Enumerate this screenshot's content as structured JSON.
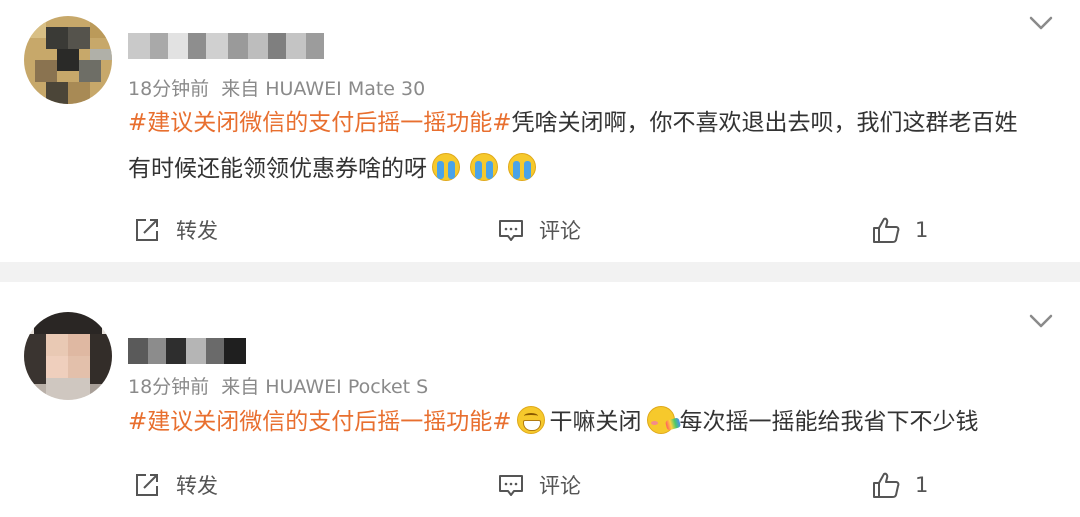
{
  "posts": [
    {
      "time": "18分钟前",
      "source": "来自 HUAWEI Mate 30",
      "topic": "#建议关闭微信的支付后摇一摇功能#",
      "text_line1": "凭啥关闭啊，你不喜欢退出去呗，我们这群老百姓",
      "text_line2": "有时候还能领领优惠券啥的呀",
      "emojis": [
        "crying-face",
        "crying-face",
        "crying-face"
      ],
      "actions": {
        "repost_label": "转发",
        "comment_label": "评论",
        "like_count": "1"
      }
    },
    {
      "time": "18分钟前",
      "source": "来自 HUAWEI Pocket S",
      "topic": "#建议关闭微信的支付后摇一摇功能#",
      "text_part1": "干嘛关闭",
      "text_part2": "每次摇一摇能给我省下不少钱",
      "emojis": [
        "grinning-face",
        "party-face"
      ],
      "actions": {
        "repost_label": "转发",
        "comment_label": "评论",
        "like_count": "1"
      }
    }
  ],
  "colors": {
    "topic": "#e86f2f",
    "meta": "#8a8a8a",
    "separator": "#f2f2f2",
    "text": "#333333"
  }
}
